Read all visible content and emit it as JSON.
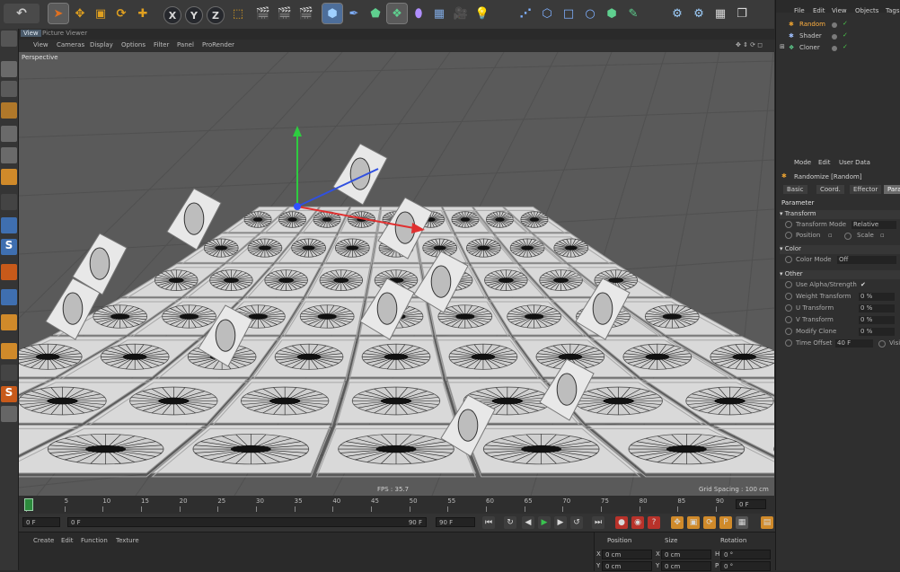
{
  "toolbar": {
    "axis_x": "X",
    "axis_y": "Y",
    "axis_z": "Z"
  },
  "viewport_tabs": {
    "view": "View",
    "other": "Picture Viewer"
  },
  "viewport_menu": [
    "View",
    "Cameras",
    "Display",
    "Options",
    "Filter",
    "Panel",
    "ProRender"
  ],
  "viewport": {
    "label": "Perspective",
    "fps": "FPS : 35.7",
    "grid_spacing": "Grid Spacing : 100 cm",
    "colors": {
      "floor": "#5a5a5a",
      "tile": "#d9d9d9",
      "tile_edge": "#9a9a9a",
      "pattern": "#1e1e1e"
    }
  },
  "timeline": {
    "ticks": [
      "0",
      "5",
      "10",
      "15",
      "20",
      "25",
      "30",
      "35",
      "40",
      "45",
      "50",
      "55",
      "60",
      "65",
      "70",
      "75",
      "80",
      "85",
      "90"
    ],
    "frame_end": "0 F",
    "start_field": "0 F",
    "min_field": "0 F",
    "max_field": "90 F",
    "end_field": "90 F"
  },
  "bottom_menu": [
    "Create",
    "Edit",
    "Function",
    "Texture"
  ],
  "coords": {
    "headers": [
      "Position",
      "Size",
      "Rotation"
    ],
    "rows": [
      {
        "axis1": "X",
        "pos": "0 cm",
        "axis2": "X",
        "size": "0 cm",
        "axis3": "H",
        "rot": "0 °"
      },
      {
        "axis1": "Y",
        "pos": "0 cm",
        "axis2": "Y",
        "size": "0 cm",
        "axis3": "P",
        "rot": "0 °"
      }
    ]
  },
  "object_manager": {
    "menu": [
      "File",
      "Edit",
      "View",
      "Objects",
      "Tags"
    ],
    "objects": [
      {
        "name": "Random",
        "selected": true
      },
      {
        "name": "Shader",
        "selected": false
      },
      {
        "name": "Cloner",
        "selected": false
      }
    ]
  },
  "attributes": {
    "menu": [
      "Mode",
      "Edit",
      "User Data"
    ],
    "title": "Randomize [Random]",
    "tabs": [
      "Basic",
      "Coord.",
      "Effector",
      "Parameter"
    ],
    "section_title": "Parameter",
    "transform_label": "Transform",
    "transform_mode_label": "Transform Mode",
    "transform_mode_value": "Relative",
    "position_label": "Position",
    "scale_label": "Scale",
    "color_label": "Color",
    "color_mode_label": "Color Mode",
    "color_mode_value": "Off",
    "other_label": "Other",
    "other_rows": [
      {
        "label": "Use Alpha/Strength",
        "value": "✔"
      },
      {
        "label": "Weight Transform",
        "value": "0 %"
      },
      {
        "label": "U Transform",
        "value": "0 %"
      },
      {
        "label": "V Transform",
        "value": "0 %"
      },
      {
        "label": "Modify Clone",
        "value": "0 %"
      },
      {
        "label": "Time Offset",
        "value": "40 F"
      }
    ],
    "visible_label": "Visi"
  }
}
